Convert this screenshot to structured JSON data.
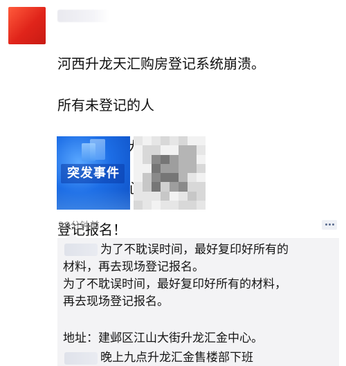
{
  "post": {
    "lines": [
      "河西升龙天汇购房登记系统崩溃。",
      "所有未登记的人",
      "去河西江山大街",
      "升龙汇金中心",
      "登记报名！"
    ],
    "news_image_label": "突发事件",
    "time": "28分钟前"
  },
  "comments": {
    "first_line": "为了不耽误时间，最好复印好所有的",
    "second_line": "材料，再去现场登记报名。",
    "third_line": "为了不耽误时间，最好复印好所有的材料，",
    "fourth_line": "再去现场登记报名。",
    "address_line": "地址：建邺区江山大街升龙汇金中心。",
    "last_line": "晚上九点升龙汇金售楼部下班"
  },
  "colors": {
    "avatar": "#e0241a",
    "comment_bg": "#f3f3f5",
    "time_text": "#8a8a8a"
  },
  "icons": {
    "comment": "comment-icon"
  }
}
